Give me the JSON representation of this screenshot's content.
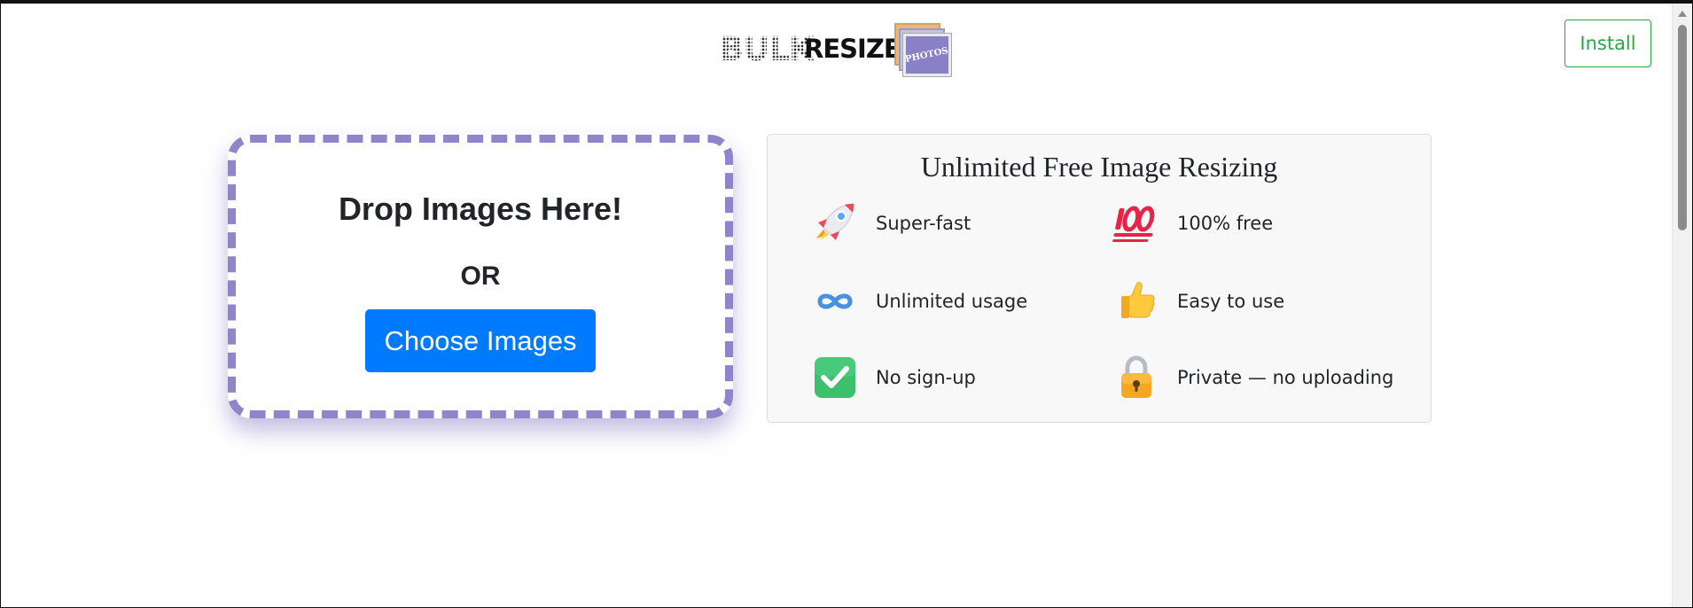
{
  "header": {
    "logo": {
      "word1": "BULK",
      "word2": "RESIZE",
      "badge": "PHOTOS"
    },
    "install_label": "Install"
  },
  "dropzone": {
    "title": "Drop Images Here!",
    "or_text": "OR",
    "button_label": "Choose Images"
  },
  "features": {
    "title": "Unlimited Free Image Resizing",
    "items": [
      {
        "label": "Super-fast",
        "icon": "rocket-icon"
      },
      {
        "label": "100% free",
        "icon": "hundred-points-icon"
      },
      {
        "label": "Unlimited usage",
        "icon": "infinity-icon"
      },
      {
        "label": "Easy to use",
        "icon": "thumbs-up-icon"
      },
      {
        "label": "No sign-up",
        "icon": "check-mark-icon"
      },
      {
        "label": "Private — no uploading",
        "icon": "lock-icon"
      }
    ]
  },
  "colors": {
    "accent": "#8f85cb",
    "primary_button": "#007bff",
    "install_green": "#28a745"
  }
}
